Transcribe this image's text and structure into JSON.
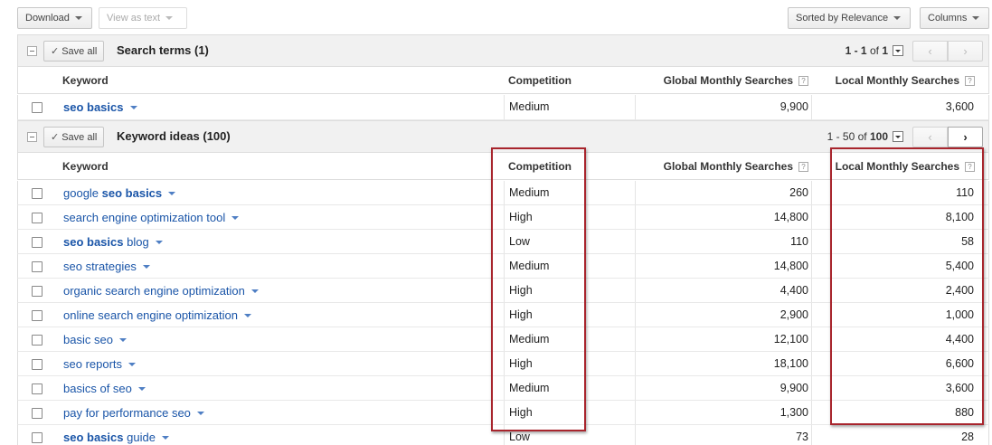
{
  "toolbar": {
    "download_label": "Download",
    "view_as_text_label": "View as text",
    "sort_label": "Sorted by Relevance",
    "columns_label": "Columns"
  },
  "search_terms": {
    "save_all_label": "Save all",
    "title": "Search terms (1)",
    "pager_range": "1 - 1",
    "pager_of": "of",
    "pager_total": "1",
    "columns": {
      "keyword": "Keyword",
      "competition": "Competition",
      "global": "Global Monthly Searches",
      "local": "Local Monthly Searches",
      "help": "?"
    },
    "rows": [
      {
        "kw_bold": "seo basics",
        "kw_rest": "",
        "competition": "Medium",
        "global": "9,900",
        "local": "3,600"
      }
    ]
  },
  "keyword_ideas": {
    "save_all_label": "Save all",
    "title": "Keyword ideas (100)",
    "pager_range": "1 - 50",
    "pager_of": "of",
    "pager_total": "100",
    "columns": {
      "keyword": "Keyword",
      "competition": "Competition",
      "global": "Global Monthly Searches",
      "local": "Local Monthly Searches",
      "help": "?"
    },
    "rows": [
      {
        "kw_pre": "google ",
        "kw_bold": "seo basics",
        "kw_rest": "",
        "competition": "Medium",
        "global": "260",
        "local": "110"
      },
      {
        "kw_pre": "search engine optimization tool",
        "kw_bold": "",
        "kw_rest": "",
        "competition": "High",
        "global": "14,800",
        "local": "8,100"
      },
      {
        "kw_pre": "",
        "kw_bold": "seo basics",
        "kw_rest": " blog",
        "competition": "Low",
        "global": "110",
        "local": "58"
      },
      {
        "kw_pre": "seo strategies",
        "kw_bold": "",
        "kw_rest": "",
        "competition": "Medium",
        "global": "14,800",
        "local": "5,400"
      },
      {
        "kw_pre": "organic search engine optimization",
        "kw_bold": "",
        "kw_rest": "",
        "competition": "High",
        "global": "4,400",
        "local": "2,400"
      },
      {
        "kw_pre": "online search engine optimization",
        "kw_bold": "",
        "kw_rest": "",
        "competition": "High",
        "global": "2,900",
        "local": "1,000"
      },
      {
        "kw_pre": "basic seo",
        "kw_bold": "",
        "kw_rest": "",
        "competition": "Medium",
        "global": "12,100",
        "local": "4,400"
      },
      {
        "kw_pre": "seo reports",
        "kw_bold": "",
        "kw_rest": "",
        "competition": "High",
        "global": "18,100",
        "local": "6,600"
      },
      {
        "kw_pre": "basics of seo",
        "kw_bold": "",
        "kw_rest": "",
        "competition": "Medium",
        "global": "9,900",
        "local": "3,600"
      },
      {
        "kw_pre": "pay for performance seo",
        "kw_bold": "",
        "kw_rest": "",
        "competition": "High",
        "global": "1,300",
        "local": "880"
      },
      {
        "kw_pre": "",
        "kw_bold": "seo basics",
        "kw_rest": " guide",
        "competition": "Low",
        "global": "73",
        "local": "28"
      }
    ]
  },
  "colors": {
    "link": "#1a55a8",
    "highlight": "#a8252d"
  }
}
